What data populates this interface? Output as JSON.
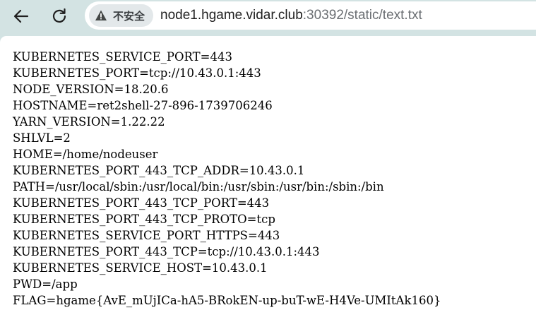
{
  "toolbar": {
    "back_icon": "back-arrow-icon",
    "reload_icon": "reload-icon",
    "security_icon": "warning-icon",
    "security_label": "不安全",
    "url_host": "node1.hgame.vidar.club",
    "url_rest": ":30392/static/text.txt"
  },
  "content": {
    "lines": [
      "KUBERNETES_SERVICE_PORT=443",
      "KUBERNETES_PORT=tcp://10.43.0.1:443",
      "NODE_VERSION=18.20.6",
      "HOSTNAME=ret2shell-27-896-1739706246",
      "YARN_VERSION=1.22.22",
      "SHLVL=2",
      "HOME=/home/nodeuser",
      "KUBERNETES_PORT_443_TCP_ADDR=10.43.0.1",
      "PATH=/usr/local/sbin:/usr/local/bin:/usr/sbin:/usr/bin:/sbin:/bin",
      "KUBERNETES_PORT_443_TCP_PORT=443",
      "KUBERNETES_PORT_443_TCP_PROTO=tcp",
      "KUBERNETES_SERVICE_PORT_HTTPS=443",
      "KUBERNETES_PORT_443_TCP=tcp://10.43.0.1:443",
      "KUBERNETES_SERVICE_HOST=10.43.0.1",
      "PWD=/app",
      "FLAG=hgame{AvE_mUjICa-hA5-BRokEN-up-buT-wE-H4Ve-UMItAk160}"
    ]
  },
  "colors": {
    "toolbar_bg": "#d3e3e3",
    "omnibox_bg": "#ffffff",
    "security_chip_bg": "#e3e8ea",
    "url_host": "#1f1f1f",
    "url_rest": "#6b6f73"
  }
}
